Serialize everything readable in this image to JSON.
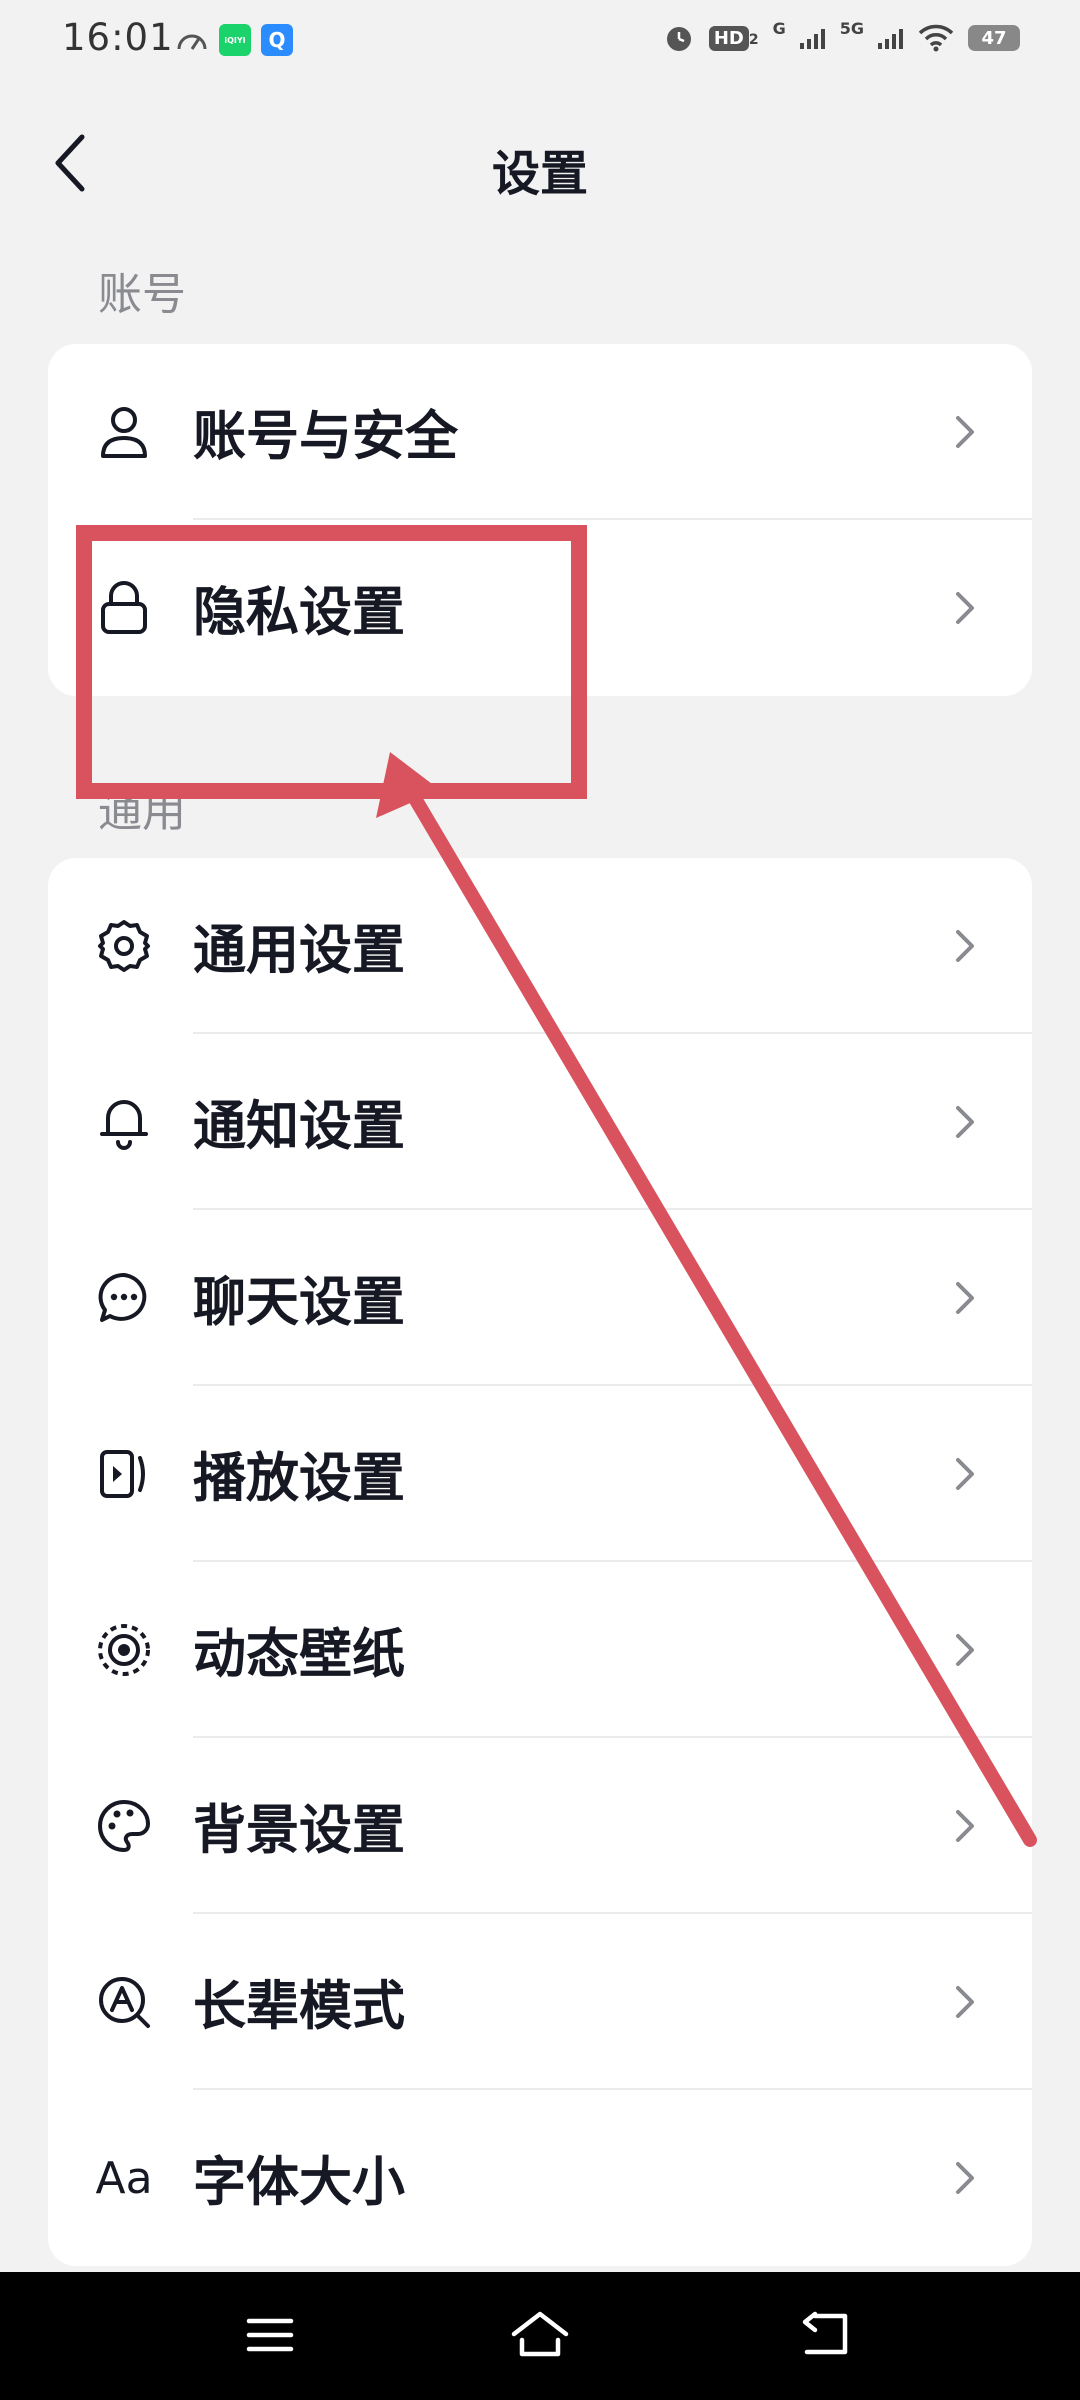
{
  "status_bar": {
    "time": "16:01",
    "app_icon_1_text": "iQIYI",
    "app_icon_2_text": "Q",
    "hd_label": "HD",
    "hd_sub": "2",
    "net1": "G",
    "net2": "5G",
    "battery": "47"
  },
  "header": {
    "title": "设置"
  },
  "sections": [
    {
      "label": "账号",
      "items": [
        {
          "label": "账号与安全",
          "icon": "person-icon"
        },
        {
          "label": "隐私设置",
          "icon": "lock-icon"
        }
      ]
    },
    {
      "label": "通用",
      "items": [
        {
          "label": "通用设置",
          "icon": "gear-icon"
        },
        {
          "label": "通知设置",
          "icon": "bell-icon"
        },
        {
          "label": "聊天设置",
          "icon": "chat-bubble-icon"
        },
        {
          "label": "播放设置",
          "icon": "play-screen-icon"
        },
        {
          "label": "动态壁纸",
          "icon": "live-wallpaper-icon"
        },
        {
          "label": "背景设置",
          "icon": "palette-icon"
        },
        {
          "label": "长辈模式",
          "icon": "elder-mode-icon"
        },
        {
          "label": "字体大小",
          "icon": "font-size-icon",
          "icon_text": "Aa"
        }
      ]
    }
  ],
  "colors": {
    "annotation": "#d9535f",
    "background": "#f2f2f2",
    "card": "#ffffff"
  }
}
